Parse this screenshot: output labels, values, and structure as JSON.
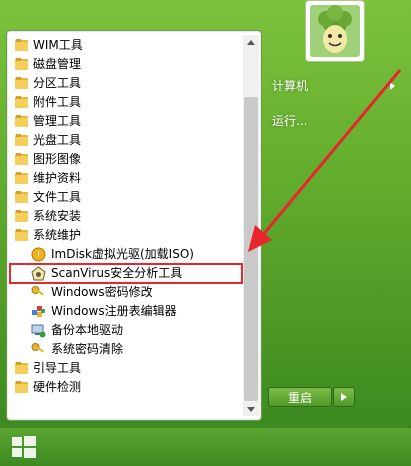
{
  "left_menu": {
    "folders_top": [
      {
        "label": "WIM工具"
      },
      {
        "label": "磁盘管理"
      },
      {
        "label": "分区工具"
      },
      {
        "label": "附件工具"
      },
      {
        "label": "管理工具"
      },
      {
        "label": "光盘工具"
      },
      {
        "label": "图形图像"
      },
      {
        "label": "维护资料"
      },
      {
        "label": "文件工具"
      },
      {
        "label": "系统安装"
      },
      {
        "label": "系统维护"
      }
    ],
    "sub_items": [
      {
        "label": "ImDisk虚拟光驱(加载ISO)",
        "icon": "imdisk-icon"
      },
      {
        "label": "ScanVirus安全分析工具",
        "icon": "scanvirus-icon"
      },
      {
        "label": "Windows密码修改",
        "icon": "key-icon"
      },
      {
        "label": "Windows注册表编辑器",
        "icon": "regedit-icon"
      },
      {
        "label": "备份本地驱动",
        "icon": "backup-driver-icon"
      },
      {
        "label": "系统密码清除",
        "icon": "key-icon"
      }
    ],
    "folders_bottom": [
      {
        "label": "引导工具"
      },
      {
        "label": "硬件检测"
      }
    ]
  },
  "right_menu": {
    "computer_label": "计算机",
    "run_label": "运行..."
  },
  "power": {
    "restart_label": "重启"
  },
  "colors": {
    "highlight_border": "#e8262c",
    "annotation_arrow": "#e8262c",
    "folder_yellow": "#e9b73e"
  }
}
